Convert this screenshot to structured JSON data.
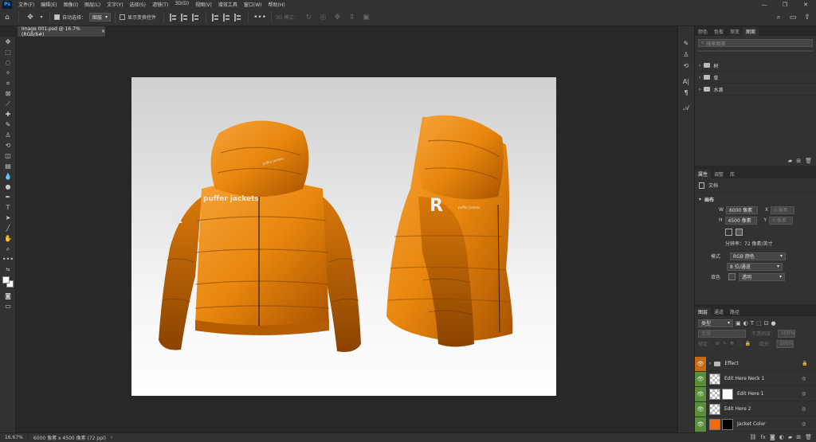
{
  "menu": [
    "文件(F)",
    "编辑(E)",
    "图像(I)",
    "图层(L)",
    "文字(Y)",
    "选择(S)",
    "滤镜(T)",
    "3D(D)",
    "视图(V)",
    "增效工具",
    "窗口(W)",
    "帮助(H)"
  ],
  "app_logo": "Ps",
  "options": {
    "auto_select_label": "自动选择：",
    "auto_select_value": "图层",
    "show_transform_label": "显示变换控件",
    "mode_3d_label": "3D 模式："
  },
  "document_tab": {
    "title": "Image 001.psd @ 16.7%(RGB/8#)",
    "close": "×"
  },
  "artwork": {
    "front_brand": "puffer jackets",
    "hood_tag": "puffer jackets",
    "side_brand": "puffer jackets",
    "logo_letter": "R",
    "jacket_color": "#e8870d"
  },
  "top_panel": {
    "tabs": [
      "颜色",
      "色板",
      "渐变",
      "图案"
    ],
    "active_tab": 3,
    "search_placeholder": "搜索图案",
    "groups": [
      "树",
      "草",
      "水滴"
    ]
  },
  "properties": {
    "tabs": [
      "属性",
      "调整",
      "库"
    ],
    "active_tab": 0,
    "doc_label": "文档",
    "section_label": "画布",
    "w_label": "W",
    "w_value": "6000 像素",
    "h_label": "H",
    "h_value": "4500 像素",
    "x_label": "X",
    "x_placeholder": "0 像素",
    "y_label": "Y",
    "y_placeholder": "0 像素",
    "resolution": "分辨率：72 像素/英寸",
    "mode_label": "模式",
    "mode_value": "RGB 颜色",
    "depth_value": "8 位/通道",
    "fill_label": "填色",
    "fill_value": "透明"
  },
  "layers_panel": {
    "tabs": [
      "图层",
      "通道",
      "路径"
    ],
    "active_tab": 0,
    "filter_label": "类型",
    "blend_mode": "正常",
    "opacity_label": "不透明度：",
    "opacity_value": "100%",
    "lock_label": "锁定：",
    "fill_label": "填充：",
    "fill_value": "100%",
    "layers": [
      {
        "name": "Effect",
        "type": "group",
        "eye": "orange"
      },
      {
        "name": "Edit Here Neck 1",
        "type": "smart",
        "eye": "green"
      },
      {
        "name": "Edit Here 1",
        "type": "smart-mask",
        "eye": "green"
      },
      {
        "name": "Edit Here 2",
        "type": "smart",
        "eye": "green"
      },
      {
        "name": "Jacket Color",
        "type": "color-mask",
        "eye": "green",
        "color": "#f26a0a"
      }
    ]
  },
  "status": {
    "zoom": "16.67%",
    "doc_size": "6000 像素 x 4500 像素 (72 ppi)"
  }
}
